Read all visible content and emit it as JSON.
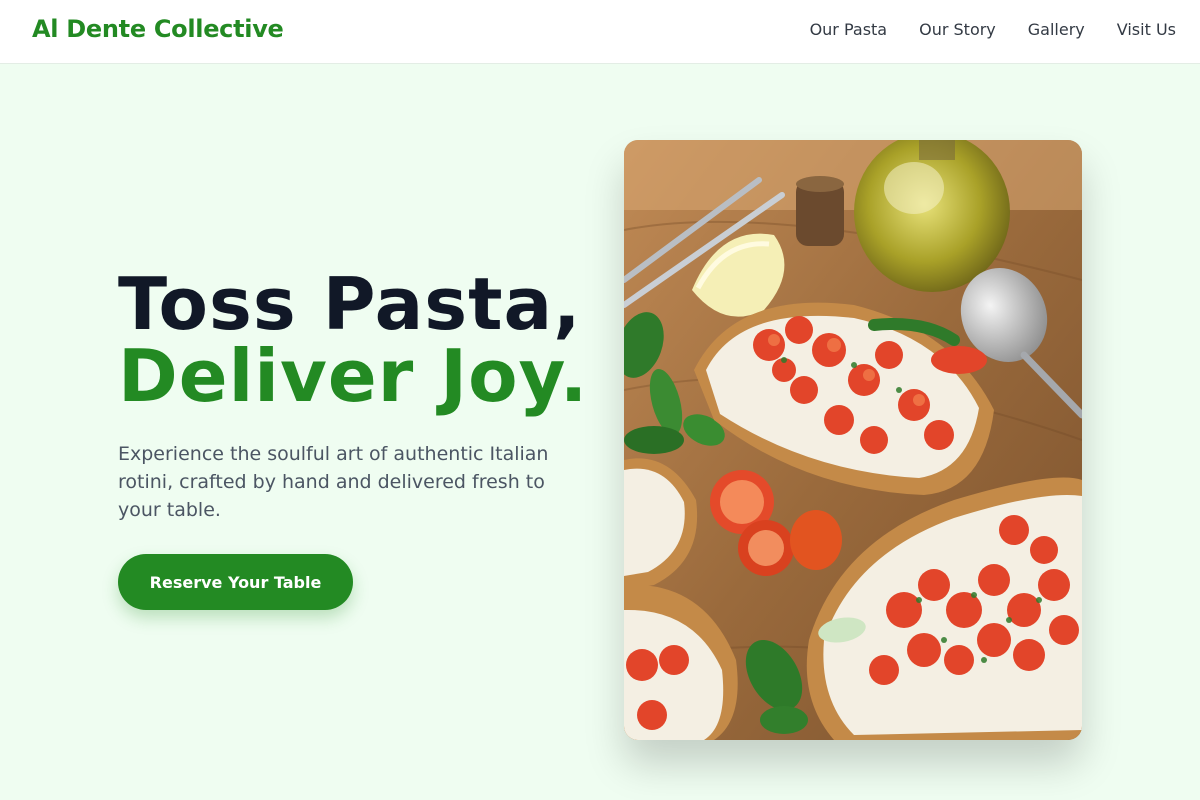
{
  "brand": {
    "name": "Al Dente Collective"
  },
  "nav": {
    "links": [
      "Our Pasta",
      "Our Story",
      "Gallery",
      "Visit Us"
    ]
  },
  "hero": {
    "title_line1": "Toss Pasta,",
    "title_line2": "Deliver Joy.",
    "subtitle": "Experience the soulful art of authentic Italian rotini, crafted by hand and delivered fresh to your table.",
    "cta_label": "Reserve Your Table"
  },
  "image": {
    "subject": "bruschetta with tomatoes, basil and ricotta on a wooden board with olive oil bottle, spoon and fork"
  },
  "colors": {
    "brand_green": "#238a23",
    "background": "#effdf1",
    "heading_dark": "#111827",
    "body_text": "#4b5563"
  }
}
